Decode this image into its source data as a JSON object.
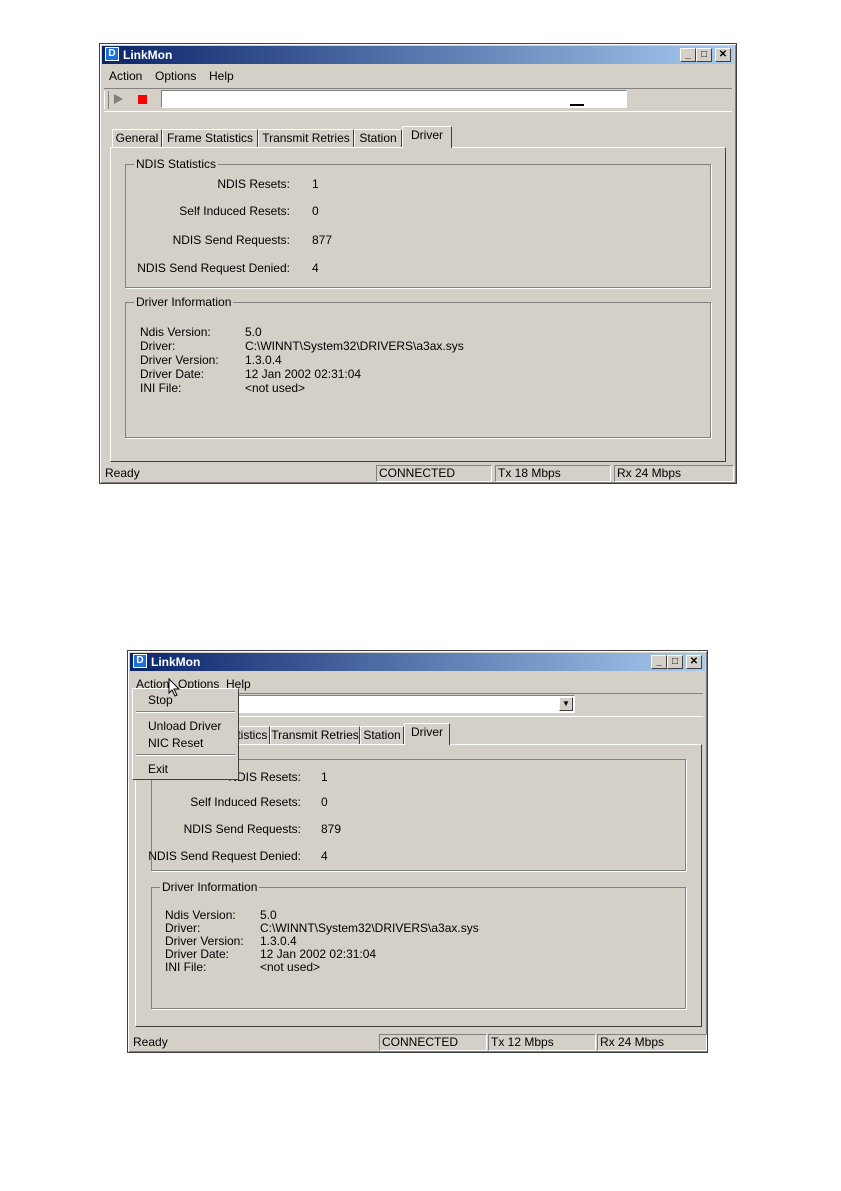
{
  "screens": [
    {
      "window": {
        "title": "LinkMon",
        "minimize": "_",
        "maximize": "□",
        "close": "✕"
      },
      "menu": [
        "Action",
        "Options",
        "Help"
      ],
      "toolbar": {
        "play_icon": "play-icon",
        "stop_icon": "stop-icon",
        "address_value": ""
      },
      "tabs": [
        "General",
        "Frame Statistics",
        "Transmit Retries",
        "Station",
        "Driver"
      ],
      "active_tab": "Driver",
      "ndis": {
        "title": "NDIS Statistics",
        "rows": [
          {
            "label": "NDIS Resets:",
            "value": "1"
          },
          {
            "label": "Self Induced Resets:",
            "value": "0"
          },
          {
            "label": "NDIS Send Requests:",
            "value": "877"
          },
          {
            "label": "NDIS Send Request Denied:",
            "value": "4"
          }
        ]
      },
      "driver_info": {
        "title": "Driver Information",
        "rows": [
          {
            "label": "Ndis Version:",
            "value": "5.0"
          },
          {
            "label": "Driver:",
            "value": "C:\\WINNT\\System32\\DRIVERS\\a3ax.sys"
          },
          {
            "label": "Driver Version:",
            "value": "1.3.0.4"
          },
          {
            "label": "Driver Date:",
            "value": "12 Jan 2002 02:31:04"
          },
          {
            "label": "INI File:",
            "value": "<not used>"
          }
        ]
      },
      "status": {
        "ready": "Ready",
        "connection": "CONNECTED",
        "tx": "Tx 18 Mbps",
        "rx": "Rx 24 Mbps"
      }
    },
    {
      "window": {
        "title": "LinkMon",
        "minimize": "_",
        "maximize": "□",
        "close": "✕"
      },
      "menu": [
        "Action",
        "Options",
        "Help"
      ],
      "action_menu": {
        "items": [
          "Stop",
          "Unload Driver",
          "NIC Reset",
          "Exit"
        ]
      },
      "tabs": [
        "atistics",
        "Transmit Retries",
        "Station",
        "Driver"
      ],
      "active_tab": "Driver",
      "ndis": {
        "rows": [
          {
            "label": "NDIS Resets:",
            "value": "1"
          },
          {
            "label": "Self Induced Resets:",
            "value": "0"
          },
          {
            "label": "NDIS Send Requests:",
            "value": "879"
          },
          {
            "label": "NDIS Send Request Denied:",
            "value": "4"
          }
        ]
      },
      "driver_info": {
        "title": "Driver Information",
        "rows": [
          {
            "label": "Ndis Version:",
            "value": "5.0"
          },
          {
            "label": "Driver:",
            "value": "C:\\WINNT\\System32\\DRIVERS\\a3ax.sys"
          },
          {
            "label": "Driver Version:",
            "value": "1.3.0.4"
          },
          {
            "label": "Driver Date:",
            "value": "12 Jan 2002 02:31:04"
          },
          {
            "label": "INI File:",
            "value": "<not used>"
          }
        ]
      },
      "status": {
        "ready": "Ready",
        "connection": "CONNECTED",
        "tx": "Tx 12 Mbps",
        "rx": "Rx 24 Mbps"
      }
    }
  ]
}
